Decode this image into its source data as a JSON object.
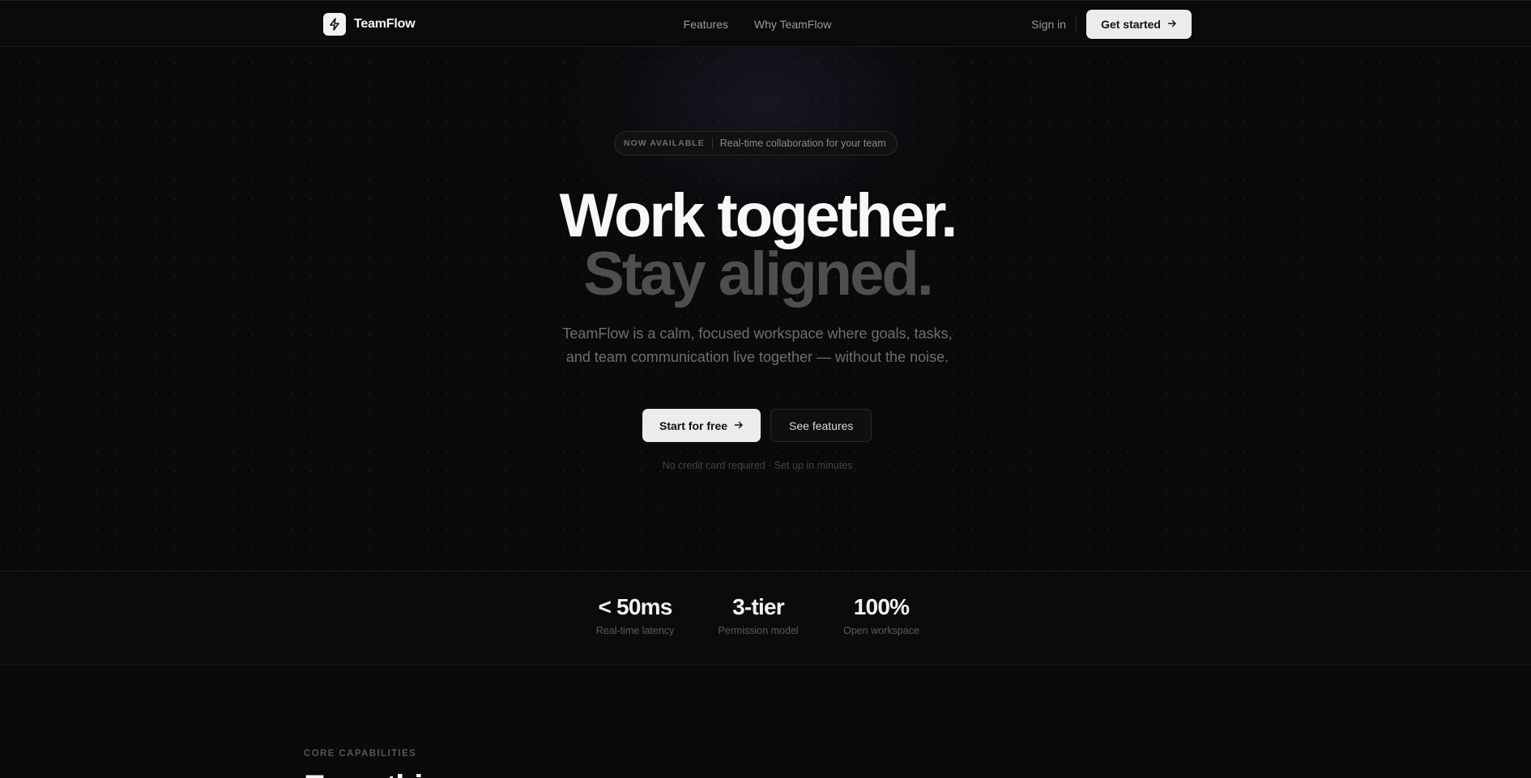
{
  "nav": {
    "brand": "TeamFlow",
    "links": [
      "Features",
      "Why TeamFlow"
    ],
    "signin": "Sign in",
    "cta": "Get started"
  },
  "hero": {
    "badge_tag": "NOW AVAILABLE",
    "badge_text": "Real-time collaboration for your team",
    "title_line1": "Work together.",
    "title_line2": "Stay aligned.",
    "subtitle_line1": "TeamFlow is a calm, focused workspace where goals, tasks,",
    "subtitle_line2": "and team communication live together — without the noise.",
    "primary_cta": "Start for free",
    "secondary_cta": "See features",
    "note": "No credit card required · Set up in minutes"
  },
  "stats": [
    {
      "value": "< 50ms",
      "label": "Real-time latency"
    },
    {
      "value": "3-tier",
      "label": "Permission model"
    },
    {
      "value": "100%",
      "label": "Open workspace"
    }
  ],
  "core": {
    "eyebrow": "CORE CAPABILITIES",
    "title": "Everything"
  },
  "colors": {
    "background": "#0a0a0a",
    "button_light": "#ececec",
    "heading": "#f7f7f7",
    "heading_muted": "#4e4e4e"
  },
  "icons": {
    "logo": "lightning-bolt-icon",
    "cta_arrow": "arrow-right-icon"
  }
}
